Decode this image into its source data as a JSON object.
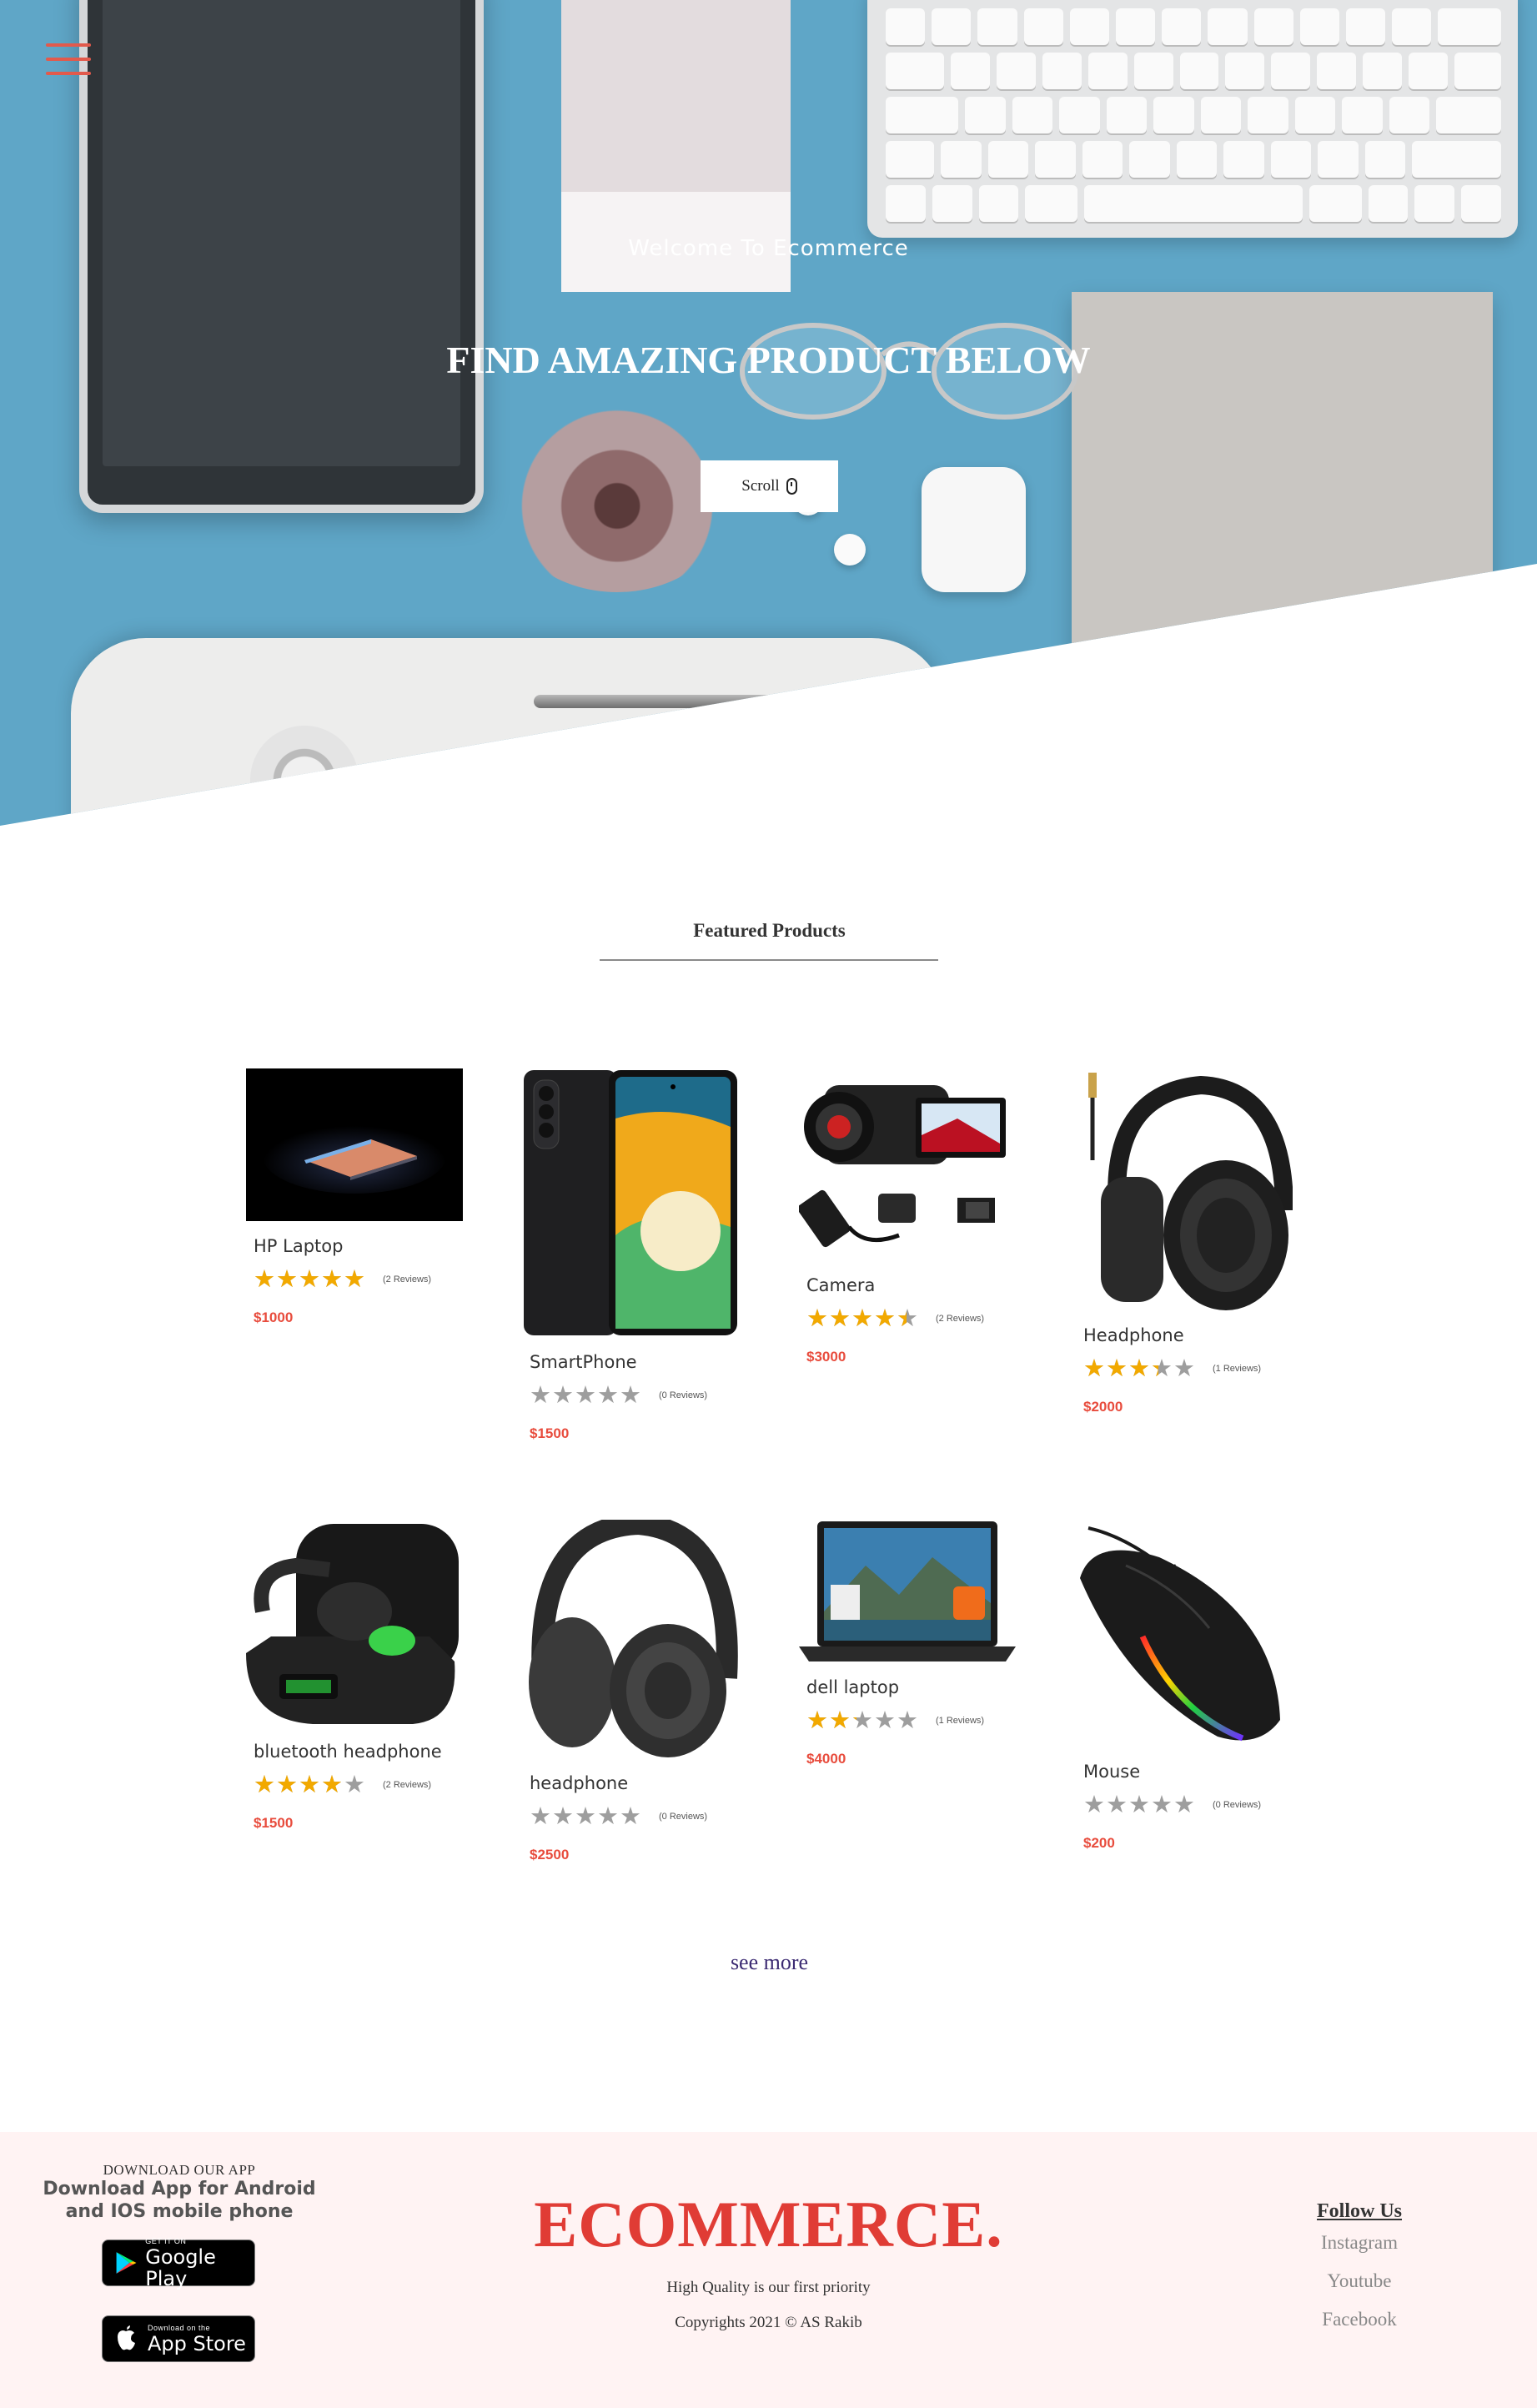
{
  "hero": {
    "welcome": "Welcome To Ecommerce",
    "title": "FIND AMAZING PRODUCT BELOW",
    "scroll_label": "Scroll"
  },
  "featured": {
    "heading": "Featured Products",
    "products": [
      {
        "name": "HP Laptop",
        "rating": 4.5,
        "reviews": "(2 Reviews)",
        "price": "$1000"
      },
      {
        "name": "SmartPhone",
        "rating": 0,
        "reviews": "(0 Reviews)",
        "price": "$1500"
      },
      {
        "name": "Camera",
        "rating": 4,
        "reviews": "(2 Reviews)",
        "price": "$3000"
      },
      {
        "name": "Headphone",
        "rating": 3,
        "reviews": "(1 Reviews)",
        "price": "$2000"
      },
      {
        "name": "bluetooth headphone",
        "rating": 3.5,
        "reviews": "(2 Reviews)",
        "price": "$1500"
      },
      {
        "name": "headphone",
        "rating": 0,
        "reviews": "(0 Reviews)",
        "price": "$2500"
      },
      {
        "name": "dell laptop",
        "rating": 2,
        "reviews": "(1 Reviews)",
        "price": "$4000"
      },
      {
        "name": "Mouse",
        "rating": 0,
        "reviews": "(0 Reviews)",
        "price": "$200"
      }
    ],
    "see_more": "see more"
  },
  "footer": {
    "download_heading": "DOWNLOAD OUR APP",
    "download_text": "Download App for Android and IOS mobile phone",
    "google_play": {
      "small": "GET IT ON",
      "big": "Google Play"
    },
    "app_store": {
      "small": "Download on the",
      "big": "App Store"
    },
    "brand": "ECOMMERCE.",
    "tagline": "High Quality is our first priority",
    "copyright": "Copyrights 2021 © AS Rakib",
    "follow_heading": "Follow Us",
    "social": [
      "Instagram",
      "Youtube",
      "Facebook"
    ]
  },
  "colors": {
    "accent": "#e03c35",
    "price": "#e84c3d",
    "star_filled": "#f2a900",
    "star_empty": "#9e9e9e",
    "hero_bg": "#5fa6c7",
    "footer_bg": "#fff3f3",
    "link": "#3b2a72"
  },
  "icons": {
    "menu": "hamburger-menu-icon",
    "scroll": "mouse-icon",
    "google_play": "google-play-icon",
    "app_store": "apple-icon"
  }
}
